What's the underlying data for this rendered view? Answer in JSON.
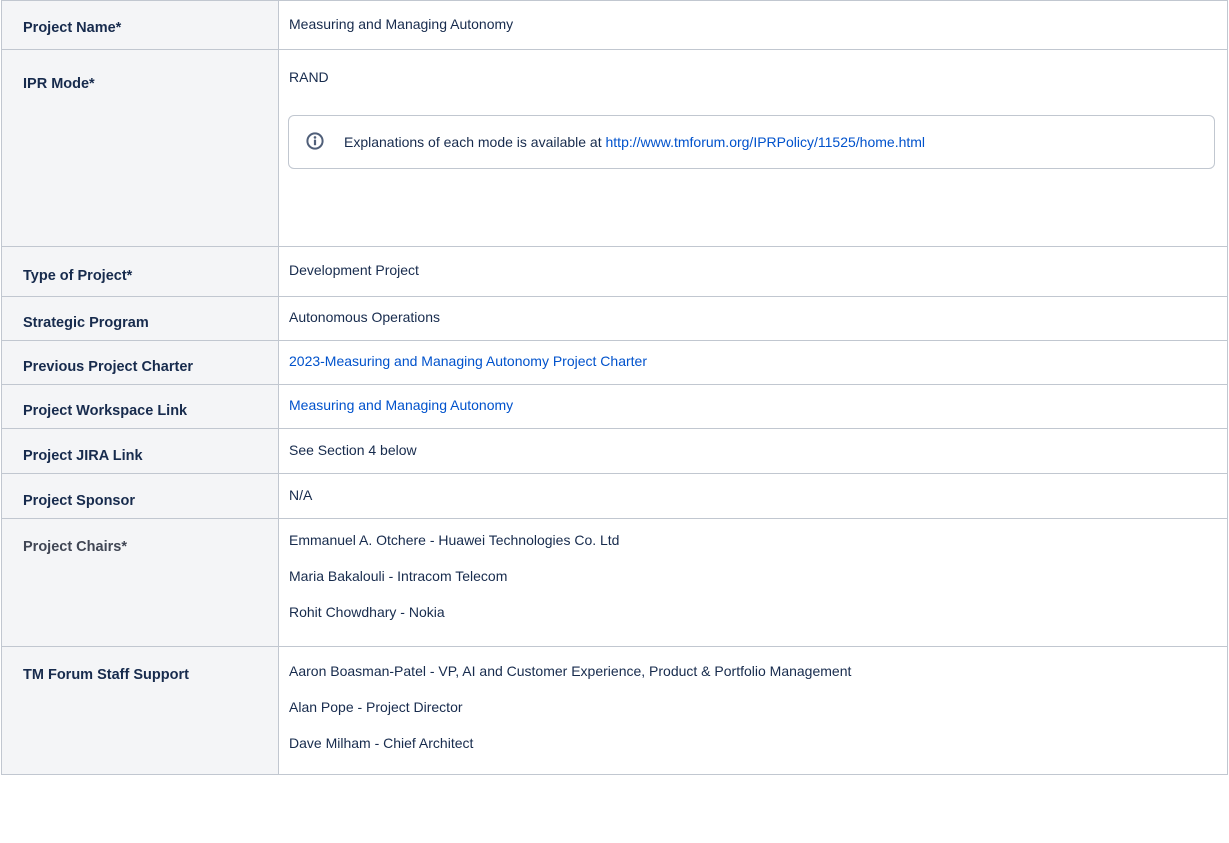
{
  "rows": {
    "project_name": {
      "label": "Project Name*",
      "value": "Measuring and Managing Autonomy"
    },
    "ipr_mode": {
      "label": "IPR Mode*",
      "value": "RAND",
      "info": {
        "icon": "info-icon",
        "text": "Explanations of each mode is available at ",
        "link": "http://www.tmforum.org/IPRPolicy/11525/home.html"
      }
    },
    "type_of_project": {
      "label": "Type of Project*",
      "value": "Development Project"
    },
    "strategic_program": {
      "label": "Strategic Program",
      "value": "Autonomous Operations"
    },
    "previous_charter": {
      "label": "Previous Project Charter",
      "link": "2023-Measuring and Managing Autonomy Project Charter"
    },
    "workspace_link": {
      "label": "Project Workspace Link",
      "link": "Measuring and Managing Autonomy"
    },
    "jira_link": {
      "label": "Project JIRA Link",
      "value": "See Section 4 below"
    },
    "sponsor": {
      "label": "Project Sponsor",
      "value": "N/A"
    },
    "chairs": {
      "label": "Project Chairs*",
      "items": [
        "Emmanuel A. Otchere - Huawei Technologies Co. Ltd",
        "Maria Bakalouli - Intracom Telecom",
        "Rohit Chowdhary - Nokia"
      ]
    },
    "staff_support": {
      "label": "TM Forum Staff Support",
      "items": [
        "Aaron Boasman-Patel - VP, AI and Customer Experience, Product & Portfolio Management",
        "Alan Pope - Project Director",
        "Dave Milham - Chief Architect"
      ]
    }
  },
  "colors": {
    "link": "#0052cc",
    "border": "#c1c7d0",
    "header_bg": "#f4f5f7",
    "text": "#172b4d"
  }
}
